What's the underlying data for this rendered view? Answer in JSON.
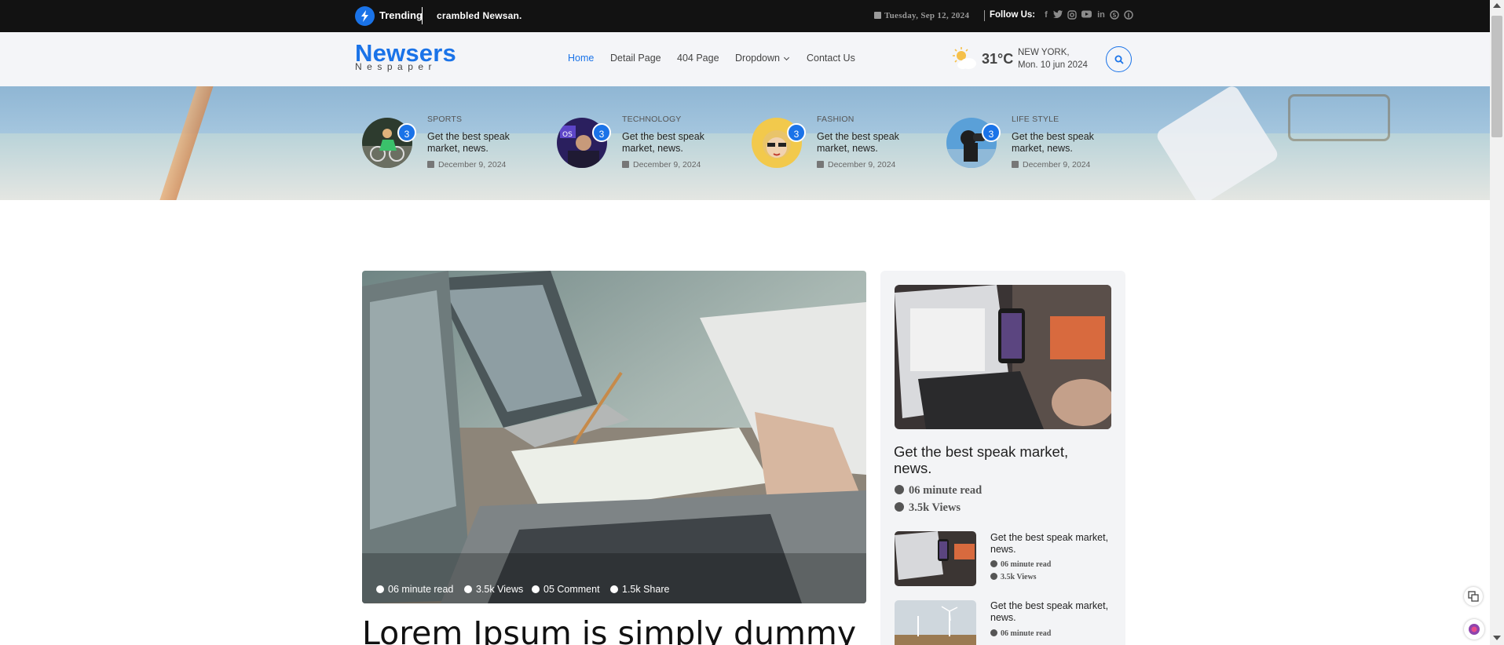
{
  "topbar": {
    "trending_label": "Trending",
    "trending_text": "crambled Newsan.",
    "date": "Tuesday, Sep 12, 2024",
    "follow_label": "Follow Us:",
    "socials": [
      "facebook-icon",
      "twitter-icon",
      "instagram-icon",
      "youtube-icon",
      "linkedin-icon",
      "skype-icon",
      "pinterest-icon"
    ]
  },
  "header": {
    "logo": "Newsers",
    "logo_sub": "Nespaper",
    "nav": [
      "Home",
      "Detail Page",
      "404 Page",
      "Dropdown",
      "Contact Us"
    ],
    "active_nav": "Home",
    "weather": {
      "temp": "31°C",
      "city": "NEW YORK,",
      "date": "Mon. 10 jun 2024"
    }
  },
  "banner": {
    "items": [
      {
        "category": "SPORTS",
        "badge": "3",
        "title": "Get the best speak market, news.",
        "date": "December 9, 2024"
      },
      {
        "category": "TECHNOLOGY",
        "badge": "3",
        "title": "Get the best speak market, news.",
        "date": "December 9, 2024"
      },
      {
        "category": "FASHION",
        "badge": "3",
        "title": "Get the best speak market, news.",
        "date": "December 9, 2024"
      },
      {
        "category": "LIFE STYLE",
        "badge": "3",
        "title": "Get the best speak market, news.",
        "date": "December 9, 2024"
      }
    ]
  },
  "main": {
    "meta": {
      "read": "06 minute read",
      "views": "3.5k Views",
      "comments": "05 Comment",
      "shares": "1.5k Share"
    },
    "headline": "Lorem Ipsum is simply dummy"
  },
  "sidebar": {
    "feature": {
      "title": "Get the best speak market, news.",
      "read": "06 minute read",
      "views": "3.5k Views"
    },
    "items": [
      {
        "title": "Get the best speak market, news.",
        "read": "06 minute read",
        "views": "3.5k Views"
      },
      {
        "title": "Get the best speak market, news.",
        "read": "06 minute read"
      }
    ]
  },
  "colors": {
    "accent": "#1a73e8",
    "topbar": "#121212",
    "header": "#f4f5f8"
  }
}
